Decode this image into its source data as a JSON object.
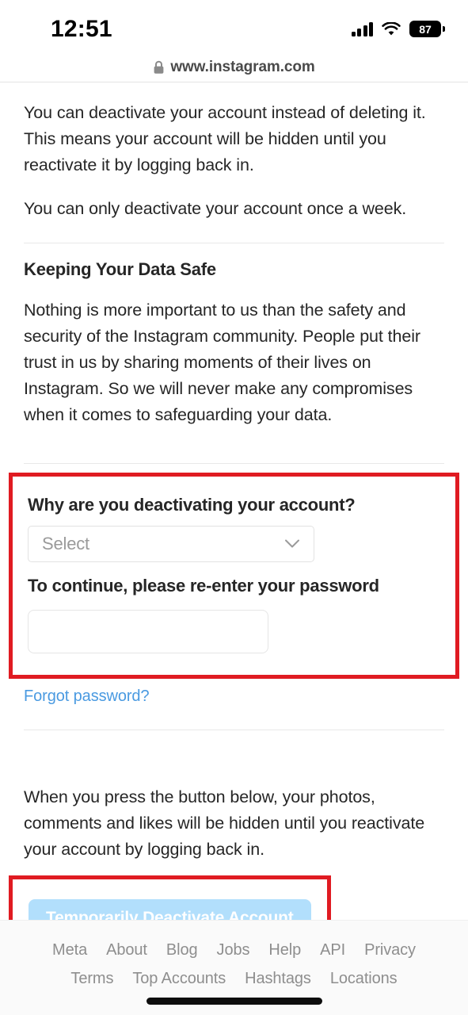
{
  "statusbar": {
    "time": "12:51",
    "battery_percent": "87",
    "icons": [
      "cellular-signal-icon",
      "wifi-icon",
      "battery-icon"
    ]
  },
  "browser": {
    "url": "www.instagram.com",
    "secure_icon": "lock-icon"
  },
  "page": {
    "paragraph_1": "You can deactivate your account instead of deleting it. This means your account will be hidden until you reactivate it by logging back in.",
    "paragraph_2": "You can only deactivate your account once a week.",
    "data_safe_heading": "Keeping Your Data Safe",
    "data_safe_body": "Nothing is more important to us than the safety and security of the Instagram community. People put their trust in us by sharing moments of their lives on Instagram. So we will never make any compromises when it comes to safeguarding your data.",
    "press_button_note": "When you press the button below, your photos, comments and likes will be hidden until you reactivate your account by logging back in."
  },
  "form": {
    "reason_label": "Why are you deactivating your account?",
    "reason_selected": "Select",
    "reason_placeholder": "Select",
    "reason_chevron_icon": "chevron-down-icon",
    "password_label": "To continue, please re-enter your password",
    "password_value": "",
    "password_placeholder": "",
    "forgot_password_link": "Forgot password?",
    "link_color": "#4a9ae1",
    "highlight_color": "#e01b22"
  },
  "actions": {
    "deactivate_button": "Temporarily Deactivate Account",
    "deactivate_button_color": "#b2dffc",
    "deactivate_button_text_color": "#ffffff"
  },
  "footer": {
    "row1": [
      "Meta",
      "About",
      "Blog",
      "Jobs",
      "Help",
      "API",
      "Privacy"
    ],
    "row2": [
      "Terms",
      "Top Accounts",
      "Hashtags",
      "Locations"
    ]
  }
}
